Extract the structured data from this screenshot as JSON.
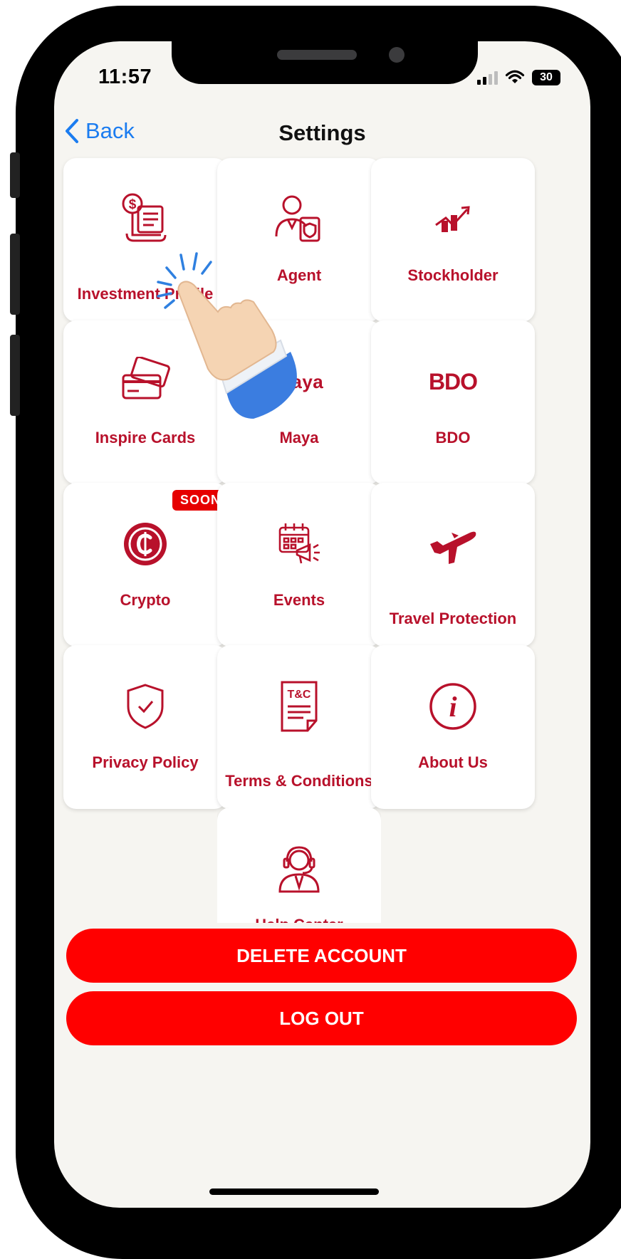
{
  "status_bar": {
    "time": "11:57",
    "battery": "30"
  },
  "nav": {
    "back_label": "Back",
    "title": "Settings"
  },
  "tiles": [
    {
      "label": "Investment Profile",
      "icon": "investment-scroll-icon"
    },
    {
      "label": "Agent",
      "icon": "agent-icon"
    },
    {
      "label": "Stockholder",
      "icon": "stock-chart-icon"
    },
    {
      "label": "Inspire Cards",
      "icon": "cards-icon"
    },
    {
      "label": "Maya",
      "icon": "maya-logo",
      "logo_text": "maya"
    },
    {
      "label": "BDO",
      "icon": "bdo-logo",
      "logo_text": "BDO"
    },
    {
      "label": "Crypto",
      "icon": "crypto-coin-icon",
      "badge": "SOON"
    },
    {
      "label": "Events",
      "icon": "events-calendar-icon"
    },
    {
      "label": "Travel Protection",
      "icon": "airplane-icon"
    },
    {
      "label": "Privacy Policy",
      "icon": "shield-check-icon"
    },
    {
      "label": "Terms & Conditions",
      "icon": "terms-document-icon",
      "icon_text": "T&C"
    },
    {
      "label": "About Us",
      "icon": "info-icon",
      "icon_text": "i"
    },
    {
      "label": "Help Center",
      "icon": "help-center-icon"
    }
  ],
  "actions": {
    "delete_label": "DELETE ACCOUNT",
    "logout_label": "LOG OUT"
  },
  "colors": {
    "brand_red": "#b8112b",
    "button_red": "#ff0000",
    "ios_blue": "#1b7cf0"
  }
}
